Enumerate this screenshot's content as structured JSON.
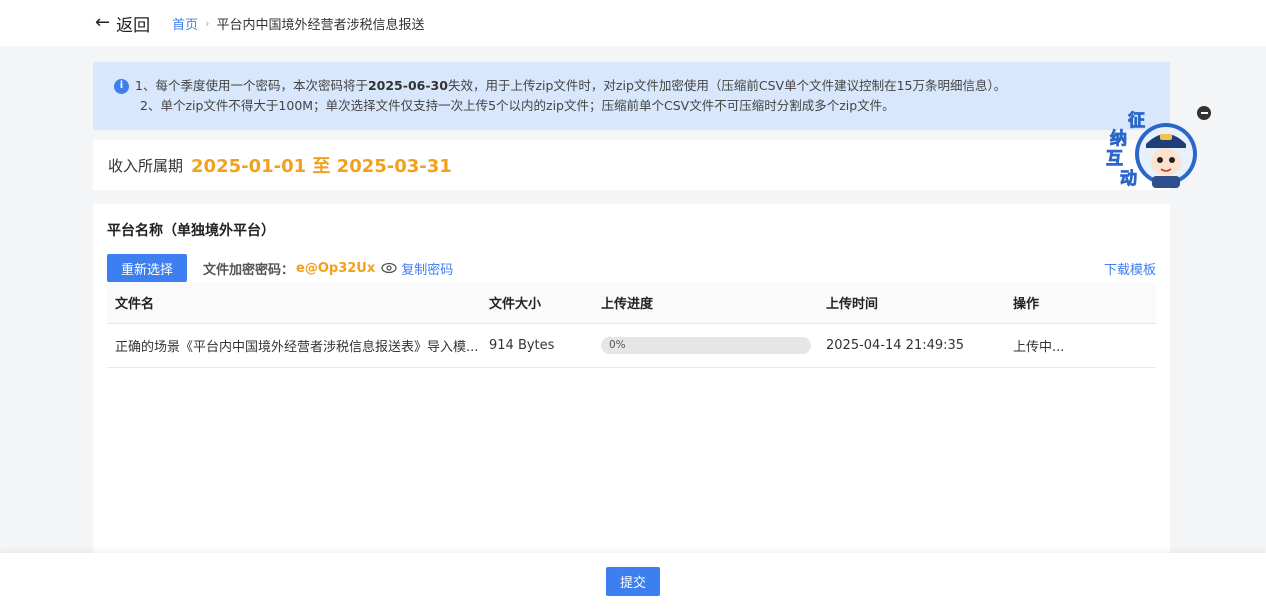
{
  "header": {
    "back_label": "返回",
    "breadcrumb_home": "首页",
    "breadcrumb_current": "平台内中国境外经营者涉税信息报送"
  },
  "notice": {
    "line1_prefix": "1、每个季度使用一个密码，本次密码将于",
    "line1_date": "2025-06-30",
    "line1_suffix": "失效，用于上传zip文件时，对zip文件加密使用（压缩前CSV单个文件建议控制在15万条明细信息）。",
    "line2": "2、单个zip文件不得大于100M；单次选择文件仅支持一次上传5个以内的zip文件；压缩前单个CSV文件不可压缩时分割成多个zip文件。"
  },
  "period": {
    "label": "收入所属期",
    "value": "2025-01-01 至 2025-03-31"
  },
  "panel": {
    "title": "平台名称（单独境外平台）",
    "reselect_label": "重新选择",
    "password_label": "文件加密密码：",
    "password_value": "e@Op32Ux",
    "copy_label": "复制密码",
    "download_label": "下载模板"
  },
  "table": {
    "headers": [
      "文件名",
      "文件大小",
      "上传进度",
      "上传时间",
      "操作"
    ],
    "rows": [
      {
        "name": "正确的场景《平台内中国境外经营者涉税信息报送表》导入模...",
        "size": "914 Bytes",
        "progress": 0,
        "progress_text": "0%",
        "time": "2025-04-14 21:49:35",
        "action": "上传中..."
      }
    ]
  },
  "mascot": {
    "chars": [
      "征",
      "纳",
      "互",
      "动"
    ]
  },
  "footer": {
    "submit_label": "提交"
  },
  "colors": {
    "primary": "#3d7ff0",
    "accent": "#f2a11f",
    "notice_bg": "#d8e7fb"
  }
}
